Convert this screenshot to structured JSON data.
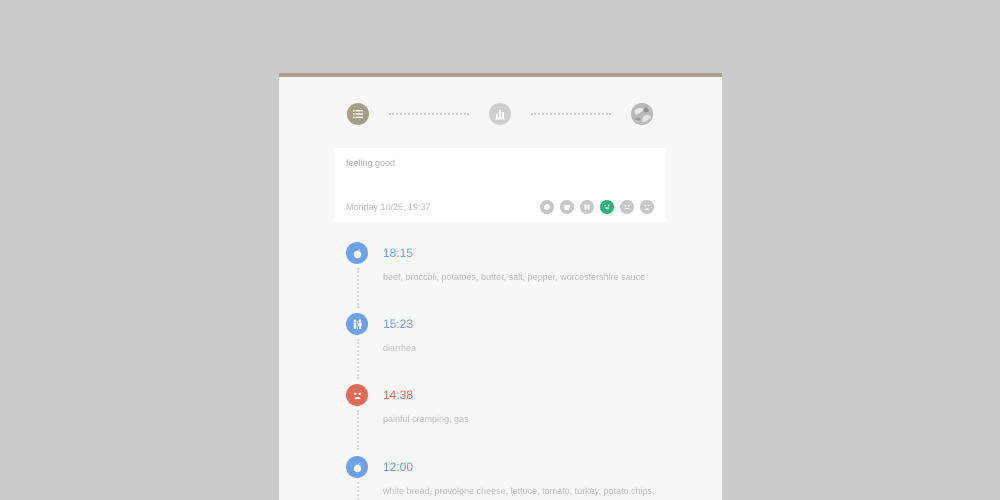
{
  "nav": {
    "icons": [
      "list-icon",
      "bar-chart-icon",
      "profile-avatar"
    ]
  },
  "entry": {
    "text": "feeling good",
    "date": "Monday 10/25, 19:37",
    "moods": [
      "mood-1-icon",
      "mood-2-icon",
      "mood-3-icon",
      "happy-face-icon",
      "neutral-face-icon",
      "sad-face-icon"
    ],
    "selected_mood": "happy-face-icon"
  },
  "timeline": [
    {
      "time": "18:15",
      "desc": "beef, broccoli, potatoes, butter, salt, pepper, worcestershire sauce",
      "icon": "meal-icon",
      "color": "#6fa0ec"
    },
    {
      "time": "15:23",
      "desc": "diarrhea",
      "icon": "restroom-icon",
      "color": "#6fa0ec"
    },
    {
      "time": "14:38",
      "desc": "painful cramping, gas",
      "icon": "sad-face-icon",
      "color": "#e06b59"
    },
    {
      "time": "12:00",
      "desc": "white bread, provolone cheese, lettuce, tomato, turkey, potato chips,",
      "icon": "meal-icon",
      "color": "#6fa0ec"
    }
  ]
}
